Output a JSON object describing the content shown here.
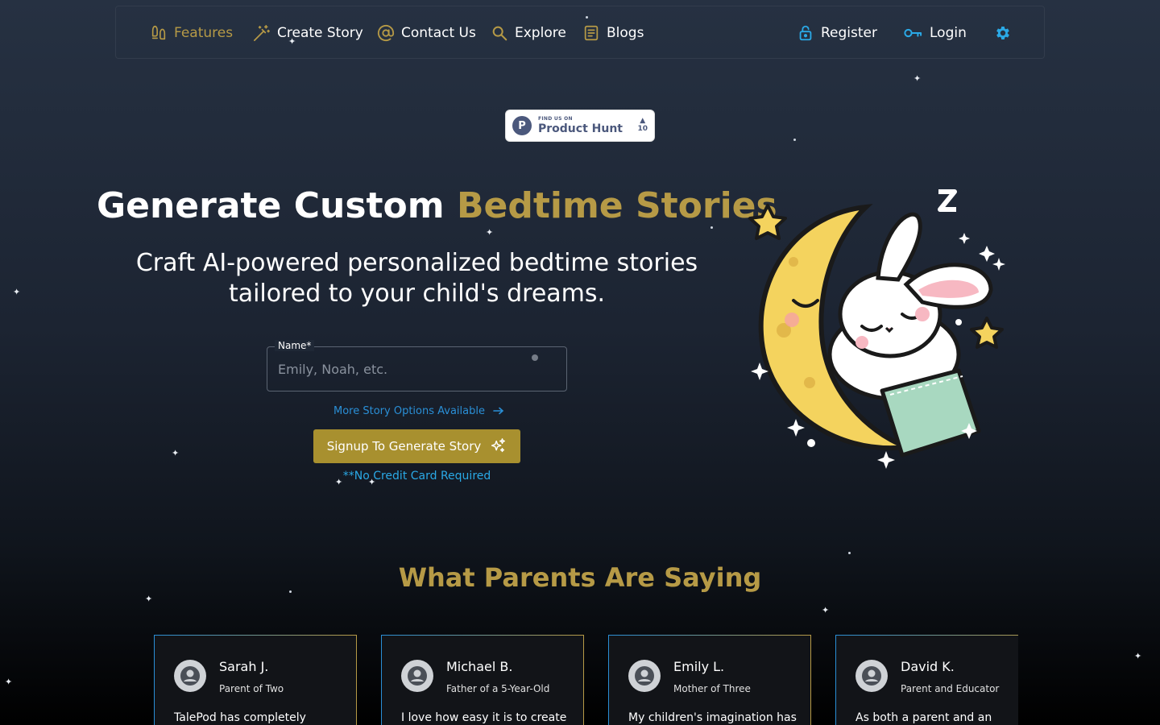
{
  "nav": {
    "features": "Features",
    "create_story": "Create Story",
    "contact_us": "Contact Us",
    "explore": "Explore",
    "blogs": "Blogs",
    "register": "Register",
    "login": "Login",
    "settings_icon": "gear-icon"
  },
  "product_hunt": {
    "small": "FIND US ON",
    "big": "Product Hunt",
    "logo_letter": "P",
    "votes": "10"
  },
  "hero": {
    "title_main": "Generate Custom",
    "title_accent": "Bedtime Stories",
    "subtitle": "Craft AI-powered personalized bedtime stories tailored to your child's dreams.",
    "name_label": "Name",
    "name_required": "*",
    "name_placeholder": "Emily, Noah, etc.",
    "more_options": "More Story Options Available",
    "cta": "Signup To Generate Story",
    "no_credit_card": "**No Credit Card Required",
    "illustration_z": "Z"
  },
  "testimonials": {
    "title": "What Parents Are Saying",
    "items": [
      {
        "name": "Sarah J.",
        "role": "Parent of Two",
        "quote": "TalePod has completely"
      },
      {
        "name": "Michael B.",
        "role": "Father of a 5-Year-Old",
        "quote": "I love how easy it is to create"
      },
      {
        "name": "Emily L.",
        "role": "Mother of Three",
        "quote": "My children's imagination has"
      },
      {
        "name": "David K.",
        "role": "Parent and Educator",
        "quote": "As both a parent and an"
      }
    ]
  },
  "colors": {
    "accent_gold": "#b69a46",
    "link_blue": "#2a8fd6",
    "cta_bg": "#a8902f"
  }
}
